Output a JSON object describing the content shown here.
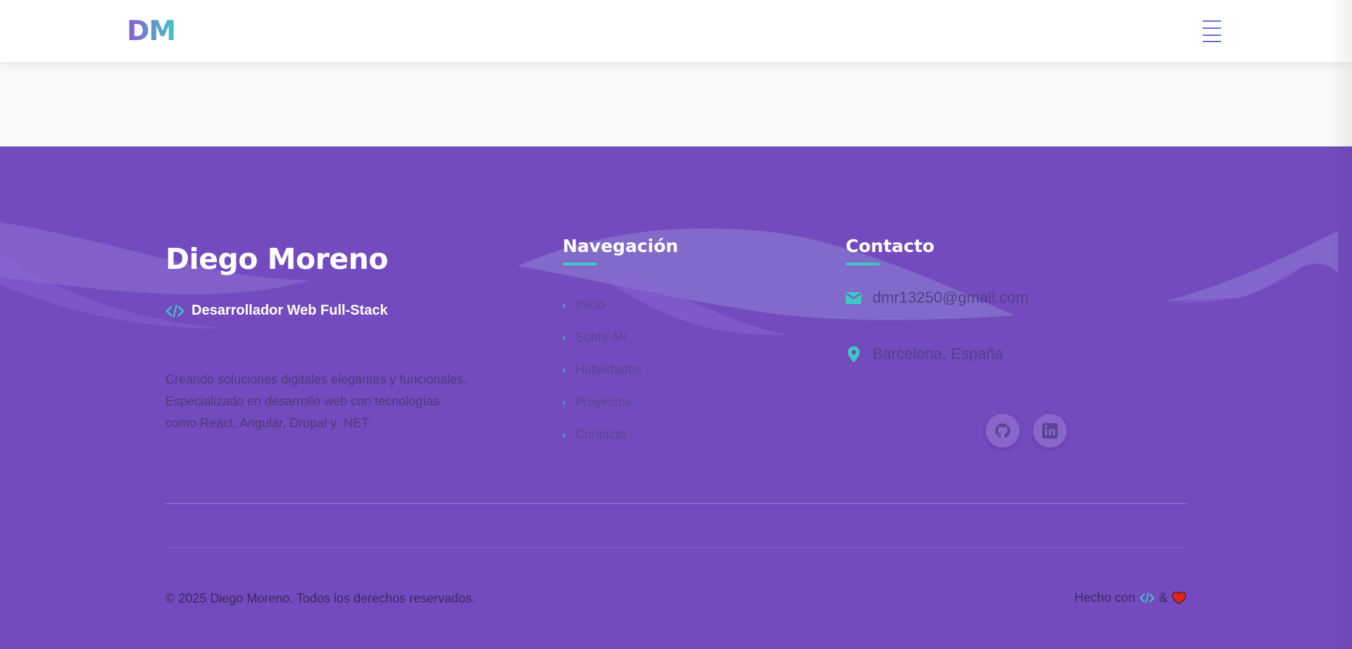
{
  "header": {
    "logo": "DM"
  },
  "footer": {
    "brand": {
      "name": "Diego Moreno",
      "role": "Desarrollador Web Full-Stack",
      "description": "Creando soluciones digitales elegantes y funcionales. Especializado en desarrollo web con tecnologías como React, Angular, Drupal y .NET."
    },
    "navigation": {
      "title": "Navegación",
      "items": [
        {
          "label": "Inicio"
        },
        {
          "label": "Sobre Mí"
        },
        {
          "label": "Habilidades"
        },
        {
          "label": "Proyectos"
        },
        {
          "label": "Contacto"
        }
      ]
    },
    "contact": {
      "title": "Contacto",
      "email": "dmr13250@gmail.com",
      "location": "Barcelona, España"
    },
    "social": [
      {
        "icon": "github-icon"
      },
      {
        "icon": "linkedin-icon"
      }
    ],
    "bottom": {
      "copyright": "© 2025 Diego Moreno. Todos los derechos reservados.",
      "made_with_prefix": "Hecho con",
      "made_with_amp": "&"
    }
  },
  "colors": {
    "footer_bg": "#744bbf",
    "accent": "#3fc7c4",
    "heart": "#e0231c"
  }
}
